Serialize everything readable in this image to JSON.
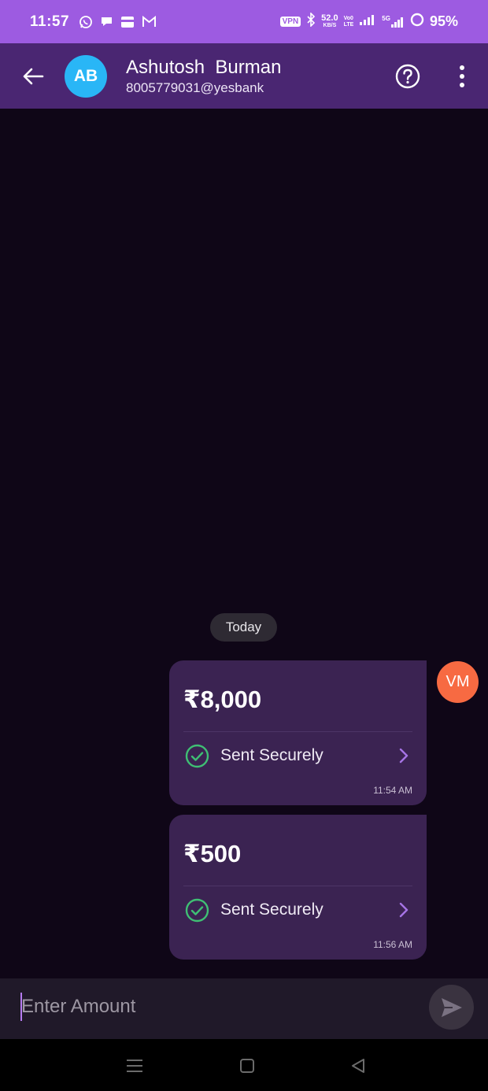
{
  "status_bar": {
    "time": "11:57",
    "vpn": "VPN",
    "net_speed": "52.0",
    "net_unit": "KB/S",
    "volte_top": "Vo0",
    "volte_bottom": "LTE",
    "signal_label": "5G",
    "battery": "95%",
    "icons": [
      "whatsapp-icon",
      "chat-bubble-icon",
      "card-icon",
      "gmail-icon",
      "bluetooth-icon",
      "signal-icon",
      "battery-ring-icon"
    ]
  },
  "header": {
    "avatar_initials": "AB",
    "avatar_color": "#29b6f6",
    "name": "Ashutosh  Burman",
    "upi_id": "8005779031@yesbank"
  },
  "chat": {
    "date_label": "Today",
    "sender_avatar": "VM",
    "sender_avatar_color": "#f76a42",
    "messages": [
      {
        "amount": "₹8,000",
        "status": "Sent Securely",
        "time": "11:54 AM"
      },
      {
        "amount": "₹500",
        "status": "Sent Securely",
        "time": "11:56 AM"
      }
    ]
  },
  "input": {
    "placeholder": "Enter Amount",
    "value": ""
  },
  "colors": {
    "status_bar": "#9d5be1",
    "app_bar": "#4a2672",
    "background": "#0f0617",
    "bubble": "#3b2352",
    "check": "#3fbf74",
    "chevron": "#a674e6"
  }
}
